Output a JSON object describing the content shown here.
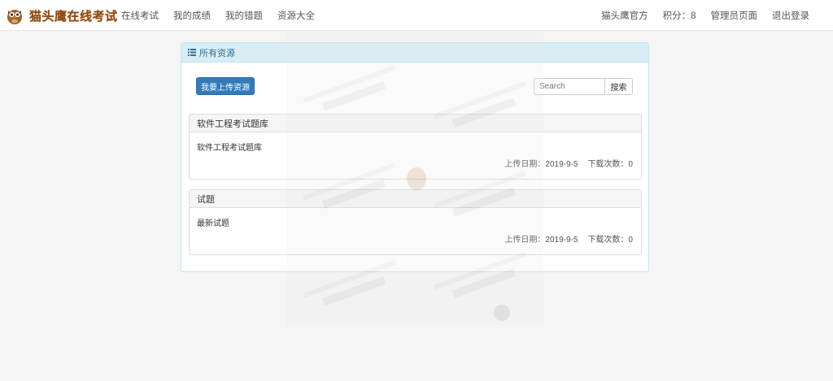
{
  "brand": {
    "title": "猫头鹰在线考试"
  },
  "nav": {
    "left": [
      "在线考试",
      "我的成绩",
      "我的错题",
      "资源大全"
    ],
    "right": [
      "猫头鹰官方",
      "积分：8",
      "管理员页面",
      "退出登录"
    ]
  },
  "panel": {
    "title": "所有资源",
    "upload_label": "我要上传资源",
    "search_placeholder": "Search",
    "search_button": "搜索"
  },
  "resources": [
    {
      "title": "软件工程考试题库",
      "description": "软件工程考试题库",
      "upload_date": "上传日期：2019-9-5",
      "downloads": "下载次数：0"
    },
    {
      "title": "试题",
      "description": "最新试题",
      "upload_date": "上传日期：2019-9-5",
      "downloads": "下载次数：0"
    }
  ],
  "colors": {
    "primary": "#337ab7",
    "panel_heading_bg": "#d9edf7",
    "panel_heading_text": "#31708f",
    "brand_text": "#8a4b1a"
  }
}
